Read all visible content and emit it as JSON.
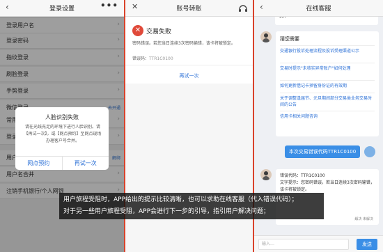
{
  "panel1": {
    "title": "登录设置",
    "more": "•••",
    "rows": [
      {
        "label": "登录用户名",
        "aside": ""
      },
      {
        "label": "登录密码",
        "aside": ""
      },
      {
        "label": "指纹登录",
        "aside": ""
      },
      {
        "label": "刷脸登录",
        "aside": ""
      },
      {
        "label": "手势登录",
        "aside": ""
      },
      {
        "label": "微信登录",
        "aside": "去开通"
      },
      {
        "label": "常用",
        "aside": ""
      },
      {
        "label": "登录",
        "aside": ""
      },
      {
        "label": "用户",
        "aside": "解绑"
      },
      {
        "label": "用户名合并",
        "aside": ""
      },
      {
        "label": "注销手机银行/个人网银",
        "aside": ""
      }
    ],
    "dialog": {
      "title": "人脸识别失败",
      "message": "请在光线充足的环境下进行人脸识别。请【再试一次】，或【网点预约】至网点现场办理客户号合并。",
      "left_button": "网点预约",
      "right_button": "再试一次"
    }
  },
  "panel2": {
    "title": "账号转账",
    "fail_title": "交易失败",
    "message": "密码错误。若您当日连续3次密码输错，该卡将被锁定。",
    "code_label": "错误码：",
    "code_value": "TTR1C0100",
    "retry": "再试一次"
  },
  "panel3": {
    "title": "在线客服",
    "top_message": "…很高兴为您服务，敬请放心，很高兴为您服务！",
    "guess_head": "猜您需要",
    "questions": [
      "交通银行投诉处理流程及投诉受理渠道公示",
      "交易时提示\"未核实异常账户\"如何处理",
      "如何更新借记卡预留身份证的有效期",
      "关于调整逢届节、元旦期间部分交易类业务交易时间的公告",
      "信用卡相关问题咨询"
    ],
    "user_message": "本次交易错误代码TTR1C0100",
    "reply": "错误代码：TTR1C0100\n文字提示：您密码错误。若当日连续3次密码输错，该卡将被锁定。",
    "feedback": "解决  未解决",
    "input_placeholder": "输入…",
    "send": "发送"
  },
  "caption": {
    "line1": "用户旅程受阻时，APP给出的提示比较清晰，也可以求助在线客服（代入错误代码）；",
    "line2": "对于另一些用户旅程受阻，APP会进行下一步的引导，指引用户解决问题；"
  }
}
